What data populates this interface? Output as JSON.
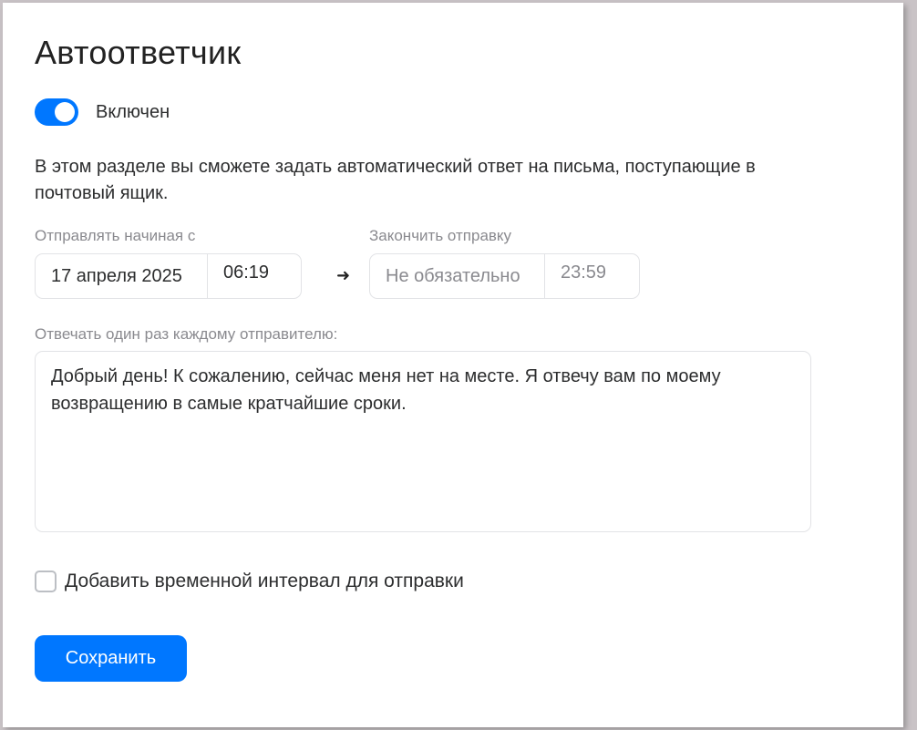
{
  "title": "Автоответчик",
  "toggle": {
    "label": "Включен",
    "on": true
  },
  "description": "В этом разделе вы сможете задать автоматический ответ на письма, поступающие в почтовый ящик.",
  "start": {
    "label": "Отправлять начиная с",
    "date": "17 апреля 2025",
    "time": "06:19"
  },
  "end": {
    "label": "Закончить отправку",
    "date_placeholder": "Не обязательно",
    "time_placeholder": "23:59"
  },
  "message": {
    "label": "Отвечать один раз каждому отправителю:",
    "text": "Добрый день! К сожалению, сейчас меня нет на месте. Я отвечу вам по моему возвращению в самые кратчайшие сроки."
  },
  "interval_checkbox": {
    "label": "Добавить временной интервал для отправки",
    "checked": false
  },
  "save_label": "Сохранить",
  "colors": {
    "accent": "#0077ff",
    "muted_text": "#8a8a8f",
    "border": "#e2e3e6"
  }
}
